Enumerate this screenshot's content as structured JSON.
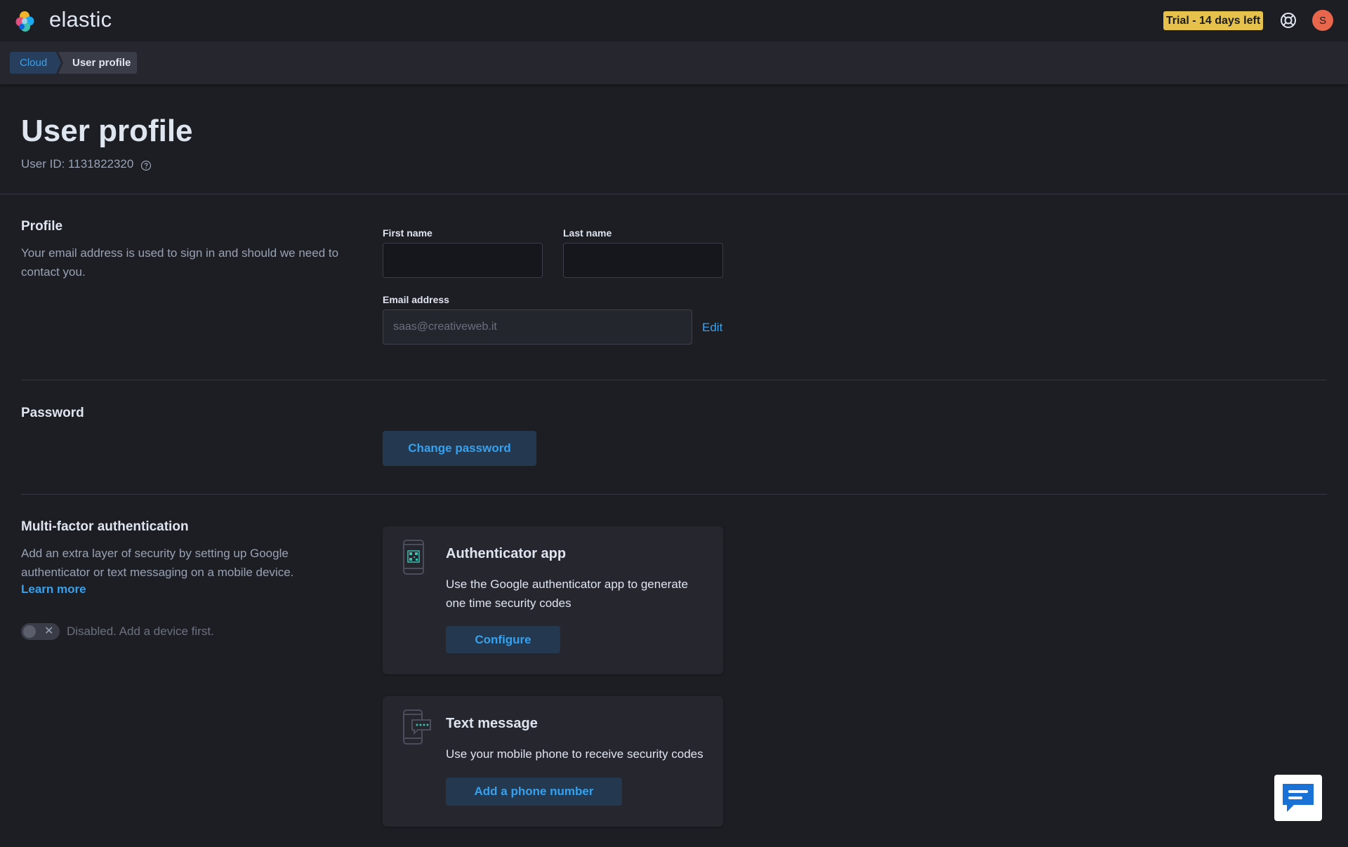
{
  "header": {
    "brand": "elastic",
    "trial_badge": "Trial - 14 days left",
    "avatar_initial": "S"
  },
  "breadcrumb": {
    "items": [
      {
        "label": "Cloud"
      },
      {
        "label": "User profile"
      }
    ]
  },
  "page": {
    "title": "User profile",
    "user_id": "User ID: 1131822320"
  },
  "profile": {
    "title": "Profile",
    "description": "Your email address is used to sign in and should we need to contact you.",
    "first_name_label": "First name",
    "first_name_value": "",
    "last_name_label": "Last name",
    "last_name_value": "",
    "email_label": "Email address",
    "email_value": "saas@creativeweb.it",
    "edit_label": "Edit"
  },
  "password": {
    "title": "Password",
    "change_label": "Change password"
  },
  "mfa": {
    "title": "Multi-factor authentication",
    "description": "Add an extra layer of security by setting up Google authenticator or text messaging on a mobile device.",
    "learn_more": "Learn more",
    "toggle_label": "Disabled. Add a device first.",
    "toggle_enabled": false,
    "cards": [
      {
        "icon": "authenticator-phone-icon",
        "title": "Authenticator app",
        "description": "Use the Google authenticator app to generate one time security codes",
        "button": "Configure"
      },
      {
        "icon": "text-message-phone-icon",
        "title": "Text message",
        "description": "Use your mobile phone to receive security codes",
        "button": "Add a phone number"
      }
    ]
  },
  "colors": {
    "background": "#1d1e24",
    "panel": "#25262e",
    "accent": "#36a2ef",
    "button_bg": "#24384f",
    "trial_badge": "#e6c24d",
    "avatar": "#e7664c"
  }
}
